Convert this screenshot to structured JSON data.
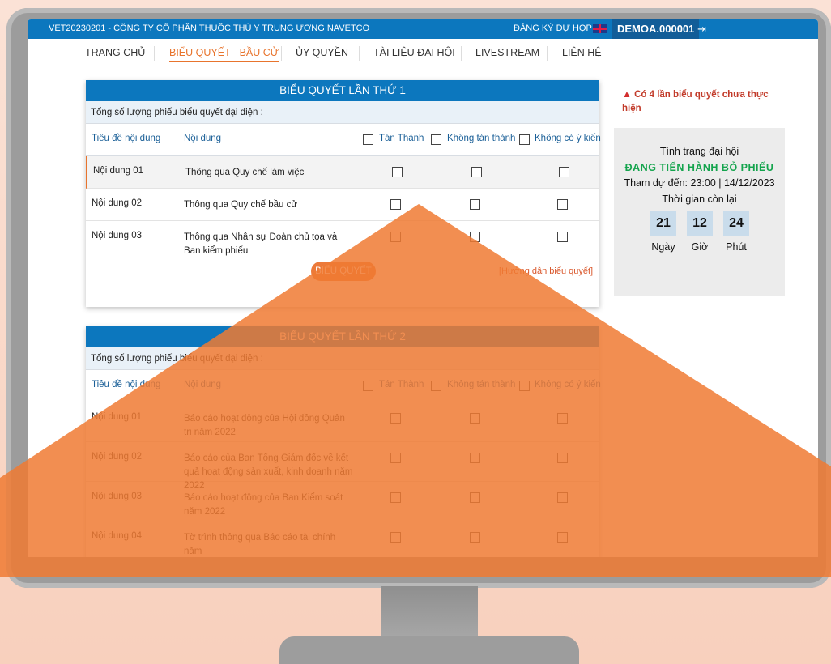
{
  "topbar": {
    "company": "VET20230201 - CÔNG TY CỔ PHẦN THUỐC THÚ Y TRUNG ƯƠNG NAVETCO",
    "register": "ĐĂNG KÝ DỰ HỌP",
    "account": "DEMOA.000001",
    "flag_icon": "uk-flag-icon",
    "logout_icon": "logout-icon"
  },
  "nav": {
    "items": [
      {
        "label": "TRANG CHỦ"
      },
      {
        "label": "BIỂU QUYẾT - BẦU CỬ"
      },
      {
        "label": "ỦY QUYỀN"
      },
      {
        "label": "TÀI LIỆU ĐẠI HỘI"
      },
      {
        "label": "LIVESTREAM"
      },
      {
        "label": "LIÊN HỆ"
      }
    ],
    "active_color": "#e8742d"
  },
  "vote1": {
    "title": "BIỂU QUYẾT LẦN THỨ 1",
    "summary": "Tổng số lượng phiếu biểu quyết đại diện :",
    "col_title": "Tiêu đề nội dung",
    "col_content": "Nội dung",
    "col_agree": "Tán Thành",
    "col_disagree": "Không tán thành",
    "col_no_opinion": "Không có ý kiến",
    "rows": [
      {
        "title": "Nội dung 01",
        "content": "Thông qua Quy chế làm việc"
      },
      {
        "title": "Nội dung 02",
        "content": "Thông qua Quy chế bầu cử"
      },
      {
        "title": "Nội dung 03",
        "content": "Thông qua Nhân sự Đoàn chủ tọa và Ban kiểm phiếu"
      }
    ],
    "submit": "BIỂU QUYẾT",
    "guide": "[Hướng dẫn biểu quyết]"
  },
  "vote2": {
    "title": "BIỂU QUYẾT LẦN THỨ 2",
    "summary": "Tổng số lượng phiếu biểu quyết đại diện :",
    "col_title": "Tiêu đề nội dung",
    "col_content": "Nội dung",
    "col_agree": "Tán Thành",
    "col_disagree": "Không tán thành",
    "col_no_opinion": "Không có ý kiến",
    "rows": [
      {
        "title": "Nội dung 01",
        "content": "Báo cáo hoạt động của Hội đồng Quản trị năm 2022"
      },
      {
        "title": "Nội dung 02",
        "content": "Báo cáo của Ban Tổng Giám đốc về kết quả hoạt động sản xuất, kinh doanh năm 2022"
      },
      {
        "title": "Nội dung 03",
        "content": "Báo cáo hoạt động của Ban Kiểm soát năm 2022"
      },
      {
        "title": "Nội dung 04",
        "content": "Tờ trình thông qua Báo cáo tài chính năm"
      }
    ]
  },
  "sidebar": {
    "warning": "Có 4 lần biểu quyết chưa thực hiện",
    "status_title": "Tình trạng đại hội",
    "status_value": "ĐANG TIẾN HÀNH BỎ PHIẾU",
    "attend_until": "Tham dự đến: 23:00 | 14/12/2023",
    "remaining_label": "Thời gian còn lại",
    "days": "21",
    "hours": "12",
    "minutes": "24",
    "days_label": "Ngày",
    "hours_label": "Giờ",
    "minutes_label": "Phút",
    "status_color": "#14a44d"
  },
  "colors": {
    "brand_blue": "#0c77be",
    "overlay_orange": "#f07a33",
    "background": "#f8d0bd"
  }
}
